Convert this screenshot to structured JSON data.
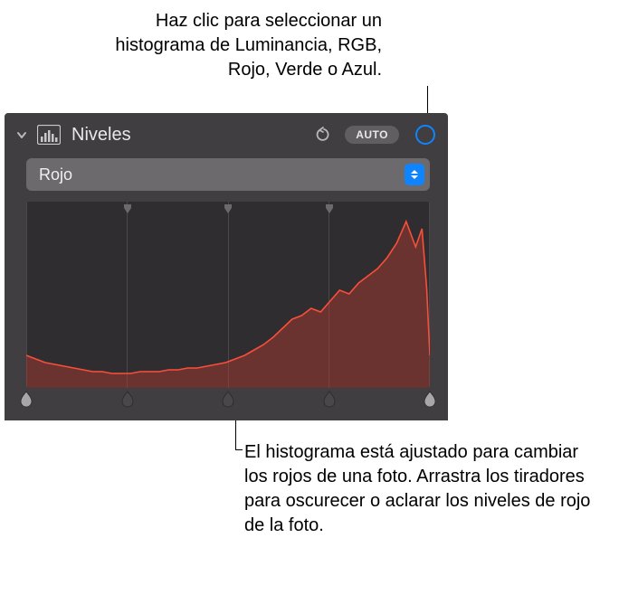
{
  "callouts": {
    "top": "Haz clic para seleccionar un histograma de Luminancia, RGB, Rojo, Verde o Azul.",
    "bottom": "El histograma está ajustado para cambiar los rojos de una foto. Arrastra los tiradores para oscurecer o aclarar los niveles de rojo de la foto."
  },
  "panel": {
    "title": "Niveles",
    "auto_label": "AUTO"
  },
  "select": {
    "value": "Rojo"
  },
  "grid_positions": [
    0,
    25,
    50,
    75,
    100
  ],
  "top_ticks": [
    25,
    50,
    75
  ],
  "handle_positions": [
    0,
    25,
    50,
    75,
    100
  ],
  "colors": {
    "histogram_stroke": "#f94f3a",
    "histogram_fill": "rgba(180,60,50,0.45)",
    "accent": "#0f84ff",
    "panel_bg": "#403e40",
    "chart_bg": "#2f2d2f"
  },
  "chart_data": {
    "type": "area",
    "title": "Rojo",
    "xlabel": "",
    "ylabel": "",
    "xlim": [
      0,
      255
    ],
    "ylim": [
      0,
      100
    ],
    "series": [
      {
        "name": "Rojo",
        "x": [
          0,
          6,
          12,
          18,
          24,
          30,
          36,
          42,
          48,
          54,
          60,
          66,
          72,
          78,
          84,
          90,
          96,
          102,
          108,
          114,
          120,
          126,
          132,
          138,
          144,
          150,
          156,
          162,
          168,
          174,
          180,
          186,
          192,
          198,
          204,
          210,
          216,
          222,
          228,
          234,
          240,
          246,
          250,
          253,
          255
        ],
        "values": [
          18,
          16,
          14,
          13,
          12,
          11,
          10,
          9,
          9,
          8,
          8,
          8,
          9,
          9,
          9,
          10,
          10,
          11,
          11,
          12,
          13,
          14,
          16,
          18,
          21,
          24,
          28,
          33,
          38,
          40,
          44,
          42,
          48,
          54,
          52,
          58,
          62,
          66,
          72,
          80,
          92,
          78,
          88,
          55,
          18
        ]
      }
    ]
  }
}
